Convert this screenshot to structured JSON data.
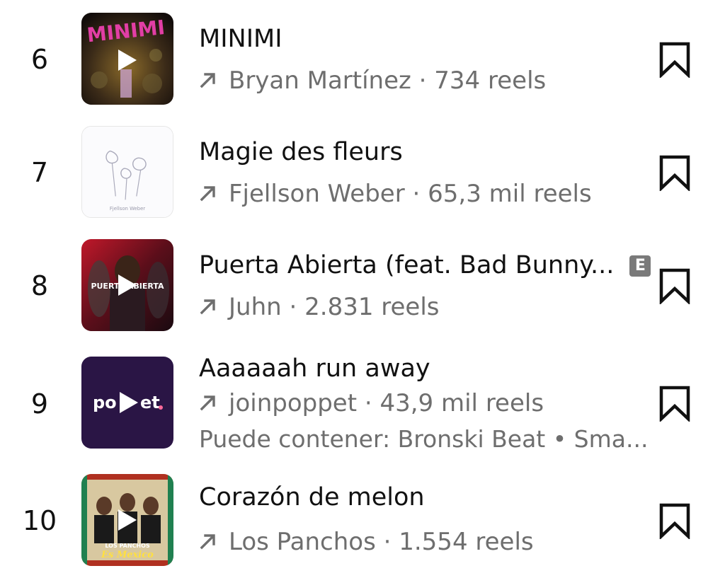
{
  "items": [
    {
      "rank": "6",
      "title": "MINIMI",
      "artist": "Bryan Martínez",
      "separator": " · ",
      "reels": "734 reels",
      "explicit": false,
      "cover_text": "MINIMI",
      "cover_icon": "play-icon"
    },
    {
      "rank": "7",
      "title": "Magie des fleurs",
      "artist": "Fjellson Weber",
      "separator": " · ",
      "reels": "65,3 mil reels",
      "explicit": false,
      "cover_text": "Fjellson Weber"
    },
    {
      "rank": "8",
      "title": "Puerta Abierta (feat. Bad Bunny...",
      "artist": "Juhn",
      "separator": " · ",
      "reels": "2.831 reels",
      "explicit": true,
      "explicit_label": "E",
      "cover_text": "PUERTA ABIERTA",
      "cover_icon": "play-icon"
    },
    {
      "rank": "9",
      "title": "Aaaaaah run away",
      "artist": "joinpoppet",
      "separator": " · ",
      "reels": "43,9 mil reels",
      "explicit": false,
      "note": "Puede contener: Bronski Beat • Sma...",
      "cover_text_left": "po",
      "cover_text_right": "et",
      "cover_icon": "play-icon"
    },
    {
      "rank": "10",
      "title": "Corazón de melon",
      "artist": "Los Panchos",
      "separator": " · ",
      "reels": "1.554 reels",
      "explicit": false,
      "cover_text_top": "LOS PANCHOS",
      "cover_text_bottom": "Es Mexico",
      "cover_icon": "play-icon"
    }
  ],
  "icons": {
    "trend": "trending-arrow-icon",
    "save": "bookmark-icon"
  },
  "colors": {
    "text_primary": "#111111",
    "text_secondary": "#6e6e6e",
    "poppet_bg": "#2a1545"
  }
}
